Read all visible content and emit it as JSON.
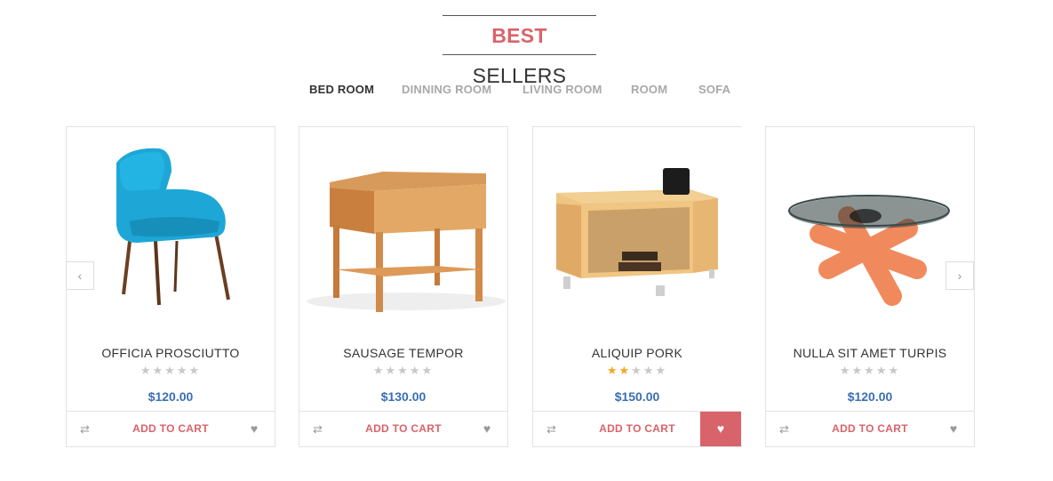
{
  "heading": {
    "accent": "BEST",
    "rest": " SELLERS"
  },
  "tabs": [
    "BED ROOM",
    "DINNING ROOM",
    "LIVING ROOM",
    "ROOM",
    "SOFA"
  ],
  "products": [
    {
      "name": "OFFICIA PROSCIUTTO",
      "price": "$120.00",
      "stars_on": 0,
      "cart_label": "ADD TO CART"
    },
    {
      "name": "SAUSAGE TEMPOR",
      "price": "$130.00",
      "stars_on": 0,
      "cart_label": "ADD TO CART"
    },
    {
      "name": "ALIQUIP PORK",
      "price": "$150.00",
      "stars_on": 2,
      "cart_label": "ADD TO CART"
    },
    {
      "name": "NULLA SIT AMET TURPIS",
      "price": "$120.00",
      "stars_on": 0,
      "cart_label": "ADD TO CART"
    }
  ],
  "icons": {
    "compare": "compare-icon",
    "wishlist": "heart-icon",
    "prev": "chevron-left-icon",
    "next": "chevron-right-icon"
  },
  "colors": {
    "accent": "#d9636a",
    "price": "#3a6fb4",
    "star_on": "#f5a623"
  }
}
